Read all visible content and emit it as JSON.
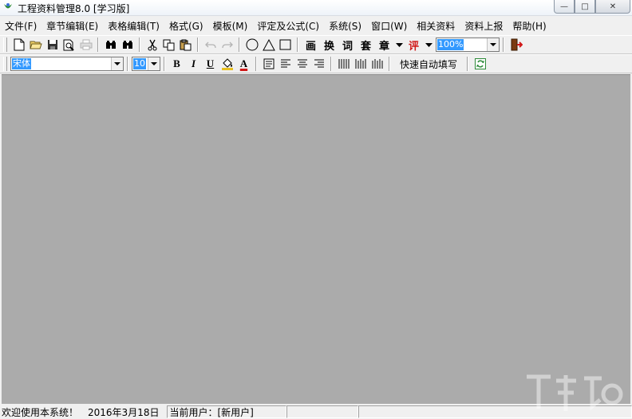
{
  "window": {
    "title": "工程资料管理8.0 [学习版]",
    "minimize_glyph": "—",
    "maximize_glyph": "□",
    "close_glyph": "✕"
  },
  "menu": [
    {
      "id": "file",
      "label": "文件(F)"
    },
    {
      "id": "chapter-edit",
      "label": "章节编辑(E)"
    },
    {
      "id": "table-edit",
      "label": "表格编辑(T)"
    },
    {
      "id": "format",
      "label": "格式(G)"
    },
    {
      "id": "template",
      "label": "模板(M)"
    },
    {
      "id": "evaluate",
      "label": "评定及公式(C)"
    },
    {
      "id": "system",
      "label": "系统(S)"
    },
    {
      "id": "window",
      "label": "窗口(W)"
    },
    {
      "id": "related",
      "label": "相关资料"
    },
    {
      "id": "upload",
      "label": "资料上报"
    },
    {
      "id": "help",
      "label": "帮助(H)"
    }
  ],
  "toolbar1": {
    "text_buttons": {
      "draw": "画",
      "swap": "换",
      "word": "词",
      "set": "套",
      "stamp": "章",
      "review": "评"
    },
    "zoom_value": "100%",
    "icons": [
      "new-file-icon",
      "open-folder-icon",
      "save-icon",
      "print-preview-icon",
      "print-icon",
      "find-icon",
      "replace-icon",
      "cut-icon",
      "copy-icon",
      "paste-icon",
      "undo-icon",
      "redo-icon",
      "circle-icon",
      "triangle-icon",
      "rectangle-icon",
      "exit-icon"
    ]
  },
  "toolbar2": {
    "font_name": "宋体",
    "font_size": "10",
    "bold_label": "B",
    "italic_label": "I",
    "underline_label": "U",
    "font_color_label": "A",
    "quick_fill_label": "快速自动填写"
  },
  "status": {
    "welcome": "欢迎使用本系统！",
    "date": "2016年3月18日",
    "user": "当前用户：[新用户]"
  },
  "colors": {
    "workspace": "#ababab",
    "selection": "#3399ff",
    "accent_red": "#d01818"
  }
}
